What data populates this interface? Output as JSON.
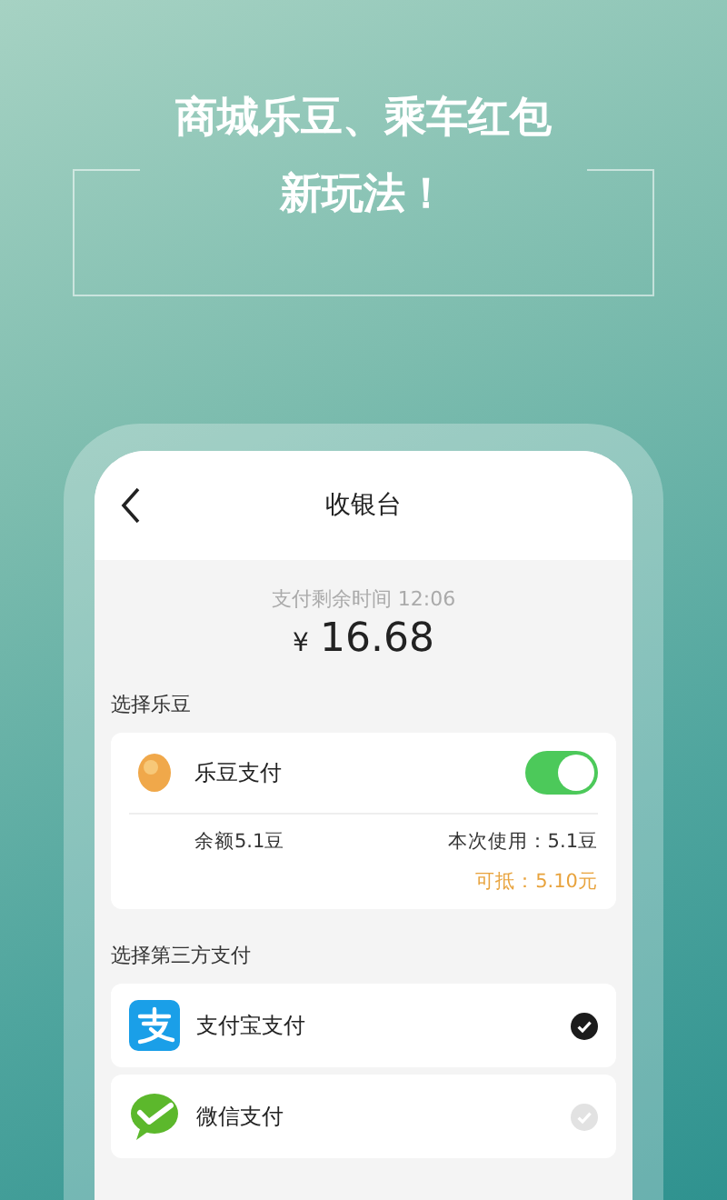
{
  "headline": [
    "商城乐豆、乘车红包",
    "新玩法！"
  ],
  "screen": {
    "title": "收银台",
    "timer": "支付剩余时间 12:06",
    "currency": "¥",
    "amount": "16.68",
    "ledou": {
      "section": "选择乐豆",
      "label": "乐豆支付",
      "on": true,
      "balance": "余额5.1豆",
      "usage": "本次使用：5.1豆",
      "deduct": "可抵：5.10元"
    },
    "third_party": {
      "section": "选择第三方支付",
      "options": [
        {
          "kind": "alipay",
          "label": "支付宝支付",
          "selected": true
        },
        {
          "kind": "wechat",
          "label": "微信支付",
          "selected": false
        }
      ]
    }
  }
}
